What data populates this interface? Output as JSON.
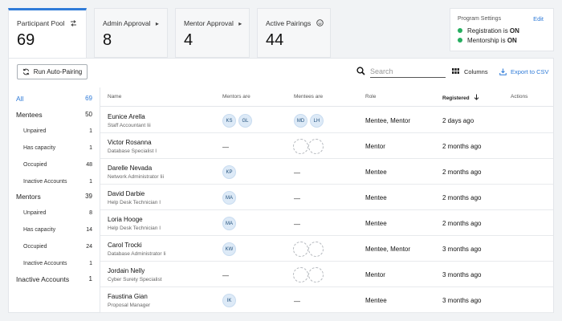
{
  "stats": [
    {
      "label": "Participant Pool",
      "value": "69",
      "icon": "swap-icon"
    },
    {
      "label": "Admin Approval",
      "value": "8",
      "icon": "caret-right-icon"
    },
    {
      "label": "Mentor Approval",
      "value": "4",
      "icon": "caret-right-icon"
    },
    {
      "label": "Active Pairings",
      "value": "44",
      "icon": "smile-icon"
    }
  ],
  "settings": {
    "title": "Program Settings",
    "edit": "Edit",
    "registration_label": "Registration is",
    "registration_value": "ON",
    "mentorship_label": "Mentorship is",
    "mentorship_value": "ON",
    "status_color": "#27ae60"
  },
  "toolbar": {
    "run_label": "Run Auto-Pairing",
    "search_placeholder": "Search",
    "columns_label": "Columns",
    "export_label": "Export to CSV"
  },
  "sidebar": {
    "all": {
      "label": "All",
      "count": "69"
    },
    "mentees": {
      "label": "Mentees",
      "count": "50"
    },
    "mentees_sub": [
      {
        "label": "Unpaired",
        "count": "1"
      },
      {
        "label": "Has capacity",
        "count": "1"
      },
      {
        "label": "Occupied",
        "count": "48"
      },
      {
        "label": "Inactive Accounts",
        "count": "1"
      }
    ],
    "mentors": {
      "label": "Mentors",
      "count": "39"
    },
    "mentors_sub": [
      {
        "label": "Unpaired",
        "count": "8"
      },
      {
        "label": "Has capacity",
        "count": "14"
      },
      {
        "label": "Occupied",
        "count": "24"
      },
      {
        "label": "Inactive Accounts",
        "count": "1"
      }
    ],
    "inactive": {
      "label": "Inactive Accounts",
      "count": "1"
    }
  },
  "table": {
    "headers": {
      "name": "Name",
      "mentors": "Mentors are",
      "mentees": "Mentees are",
      "role": "Role",
      "registered": "Registered",
      "actions": "Actions"
    },
    "dash": "—",
    "rows": [
      {
        "name": "Eunice Arella",
        "title": "Staff Accountant Iii",
        "mentors": [
          "KS",
          "GL"
        ],
        "mentees": [
          "MD",
          "LH"
        ],
        "mentees_empty": false,
        "role": "Mentee, Mentor",
        "registered": "2 days ago"
      },
      {
        "name": "Victor Rosanna",
        "title": "Database Specialist I",
        "mentors": [],
        "mentees": [],
        "mentees_empty": true,
        "role": "Mentor",
        "registered": "2 months ago"
      },
      {
        "name": "Darelle Nevada",
        "title": "Network Administrator Iii",
        "mentors": [
          "KP"
        ],
        "mentees": [],
        "mentees_empty": false,
        "role": "Mentee",
        "registered": "2 months ago"
      },
      {
        "name": "David Darbie",
        "title": "Help Desk Technician I",
        "mentors": [
          "MA"
        ],
        "mentees": [],
        "mentees_empty": false,
        "role": "Mentee",
        "registered": "2 months ago"
      },
      {
        "name": "Loria Hooge",
        "title": "Help Desk Technician I",
        "mentors": [
          "MA"
        ],
        "mentees": [],
        "mentees_empty": false,
        "role": "Mentee",
        "registered": "2 months ago"
      },
      {
        "name": "Carol Trocki",
        "title": "Database Administrator Ii",
        "mentors": [
          "KW"
        ],
        "mentees": [],
        "mentees_empty": true,
        "role": "Mentee, Mentor",
        "registered": "3 months ago"
      },
      {
        "name": "Jordain Nelly",
        "title": "Cyber Surety Specialist",
        "mentors": [],
        "mentees": [],
        "mentees_empty": true,
        "role": "Mentor",
        "registered": "3 months ago"
      },
      {
        "name": "Faustina Gian",
        "title": "Proposal Manager",
        "mentors": [
          "IK"
        ],
        "mentees": [],
        "mentees_empty": false,
        "role": "Mentee",
        "registered": "3 months ago"
      }
    ]
  }
}
